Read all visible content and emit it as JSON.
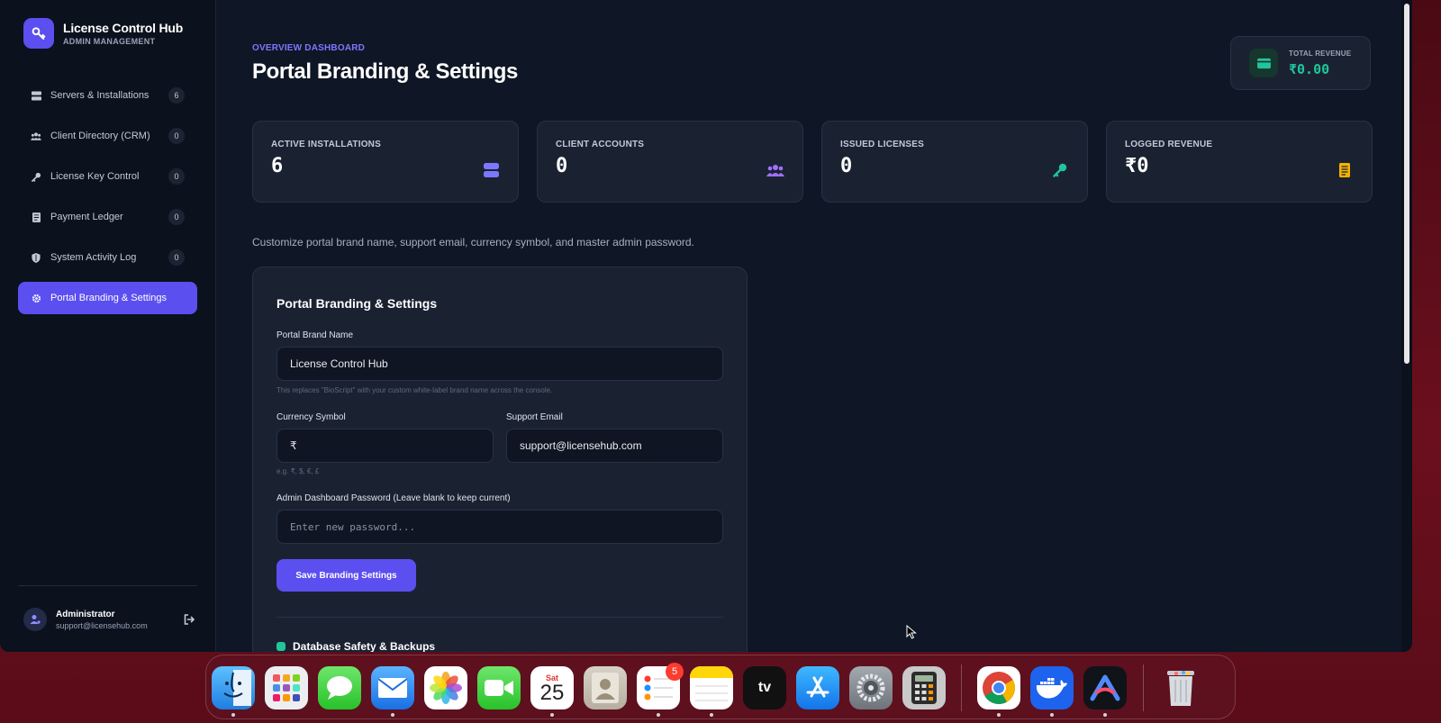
{
  "brand": {
    "title": "License Control Hub",
    "subtitle": "ADMIN MANAGEMENT"
  },
  "nav": [
    {
      "label": "Servers & Installations",
      "badge": "6",
      "icon": "server-icon"
    },
    {
      "label": "Client Directory (CRM)",
      "badge": "0",
      "icon": "users-icon"
    },
    {
      "label": "License Key Control",
      "badge": "0",
      "icon": "key-icon"
    },
    {
      "label": "Payment Ledger",
      "badge": "0",
      "icon": "receipt-icon"
    },
    {
      "label": "System Activity Log",
      "badge": "0",
      "icon": "shield-icon"
    },
    {
      "label": "Portal Branding & Settings",
      "badge": null,
      "icon": "gear-icon",
      "active": true
    }
  ],
  "user": {
    "name": "Administrator",
    "email": "support@licensehub.com"
  },
  "header": {
    "eyebrow": "OVERVIEW DASHBOARD",
    "title": "Portal Branding & Settings"
  },
  "revenue": {
    "label": "TOTAL REVENUE",
    "value": "₹0.00"
  },
  "stats": [
    {
      "label": "ACTIVE INSTALLATIONS",
      "value": "6",
      "icon": "server-icon",
      "color": "#7c77ff"
    },
    {
      "label": "CLIENT ACCOUNTS",
      "value": "0",
      "icon": "users-icon",
      "color": "#a070ff"
    },
    {
      "label": "ISSUED LICENSES",
      "value": "0",
      "icon": "key-icon",
      "color": "#22c59a"
    },
    {
      "label": "LOGGED REVENUE",
      "value": "₹0",
      "icon": "receipt-icon",
      "color": "#f5b300"
    }
  ],
  "intro": "Customize portal brand name, support email, currency symbol, and master admin password.",
  "form": {
    "title": "Portal Branding & Settings",
    "brand_name_label": "Portal Brand Name",
    "brand_name_value": "License Control Hub",
    "brand_name_hint": "This replaces \"BioScript\" with your custom white-label brand name across the console.",
    "currency_label": "Currency Symbol",
    "currency_value": "₹",
    "currency_hint": "e.g. ₹, $, €, £",
    "email_label": "Support Email",
    "email_value": "support@licensehub.com",
    "password_label": "Admin Dashboard Password (Leave blank to keep current)",
    "password_placeholder": "Enter new password...",
    "save_label": "Save Branding Settings",
    "next_section": "Database Safety & Backups"
  },
  "dock": {
    "calendar_month": "Sat",
    "calendar_day": "25",
    "reminders_badge": "5",
    "apps": [
      "finder-icon",
      "launchpad-icon",
      "messages-icon",
      "mail-icon",
      "photos-icon",
      "facetime-icon",
      "calendar-icon",
      "contacts-icon",
      "reminders-icon",
      "notes-icon",
      "apple-tv-icon",
      "app-store-icon",
      "system-settings-icon",
      "calculator-icon",
      "chrome-icon",
      "docker-icon",
      "arc-icon",
      "trash-icon"
    ]
  },
  "colors": {
    "accent": "#5b4ff0",
    "success": "#22c59a",
    "warning": "#f5b300"
  }
}
